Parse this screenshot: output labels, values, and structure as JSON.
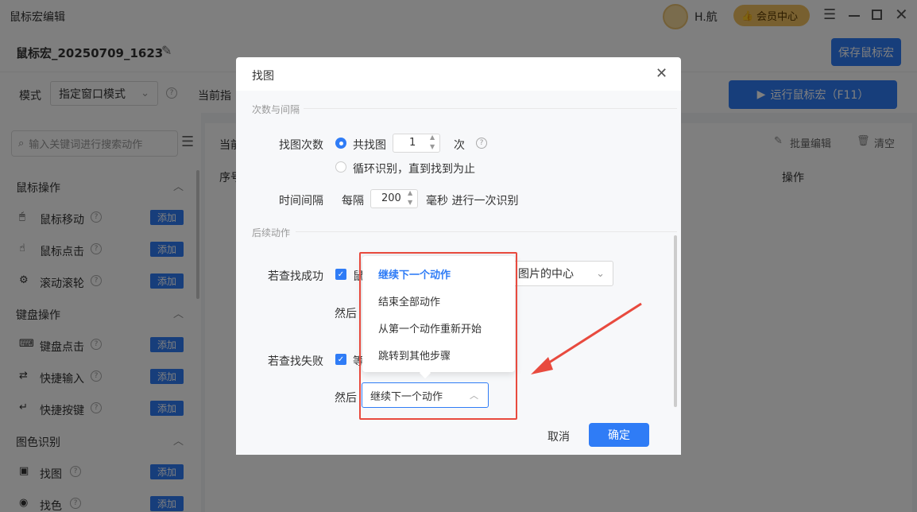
{
  "app": {
    "title": "鼠标宏编辑",
    "user": "H.航",
    "vip_label": "会员中心",
    "macro_name": "鼠标宏_20250709_1623",
    "save_label": "保存鼠标宏",
    "mode_label": "模式",
    "mode_value": "指定窗口模式",
    "current_label": "当前指",
    "run_label": "运行鼠标宏（F11）"
  },
  "sidebar": {
    "search_placeholder": "输入关键词进行搜索动作",
    "add_label": "添加",
    "groups": {
      "mouse": "鼠标操作",
      "keyboard": "键盘操作",
      "color": "图色识别"
    },
    "items": {
      "mouse_move": "鼠标移动",
      "mouse_click": "鼠标点击",
      "scroll": "滚动滚轮",
      "key_click": "键盘点击",
      "quick_input": "快捷输入",
      "quick_key": "快捷按键",
      "find_image": "找图",
      "find_color": "找色"
    }
  },
  "main": {
    "current_label": "当前",
    "seq_header": "序号",
    "ops_header": "操作",
    "batch_edit": "批量编辑",
    "clear": "清空"
  },
  "dialog": {
    "title": "找图",
    "section1": "次数与间隔",
    "count_label": "找图次数",
    "radio1_label": "共找图",
    "count_value": "1",
    "count_unit": "次",
    "radio2_label": "循环识别，直到找到为止",
    "interval_label": "时间间隔",
    "every_label": "每隔",
    "interval_value": "200",
    "interval_suffix": "毫秒 进行一次识别",
    "section2": "后续动作",
    "success_label": "若查找成功",
    "success_check_text": "鼠",
    "success_select_text": "图片的中心",
    "then_label": "然后",
    "fail_label": "若查找失败",
    "fail_check_text": "等",
    "fail_select_text": "继续下一个动作",
    "cancel": "取消",
    "confirm": "确定"
  },
  "dropdown": {
    "options": [
      "继续下一个动作",
      "结束全部动作",
      "从第一个动作重新开始",
      "跳转到其他步骤"
    ],
    "selected": "继续下一个动作"
  },
  "colors": {
    "accent": "#2f7cf6",
    "annotation": "#e84a3e"
  }
}
